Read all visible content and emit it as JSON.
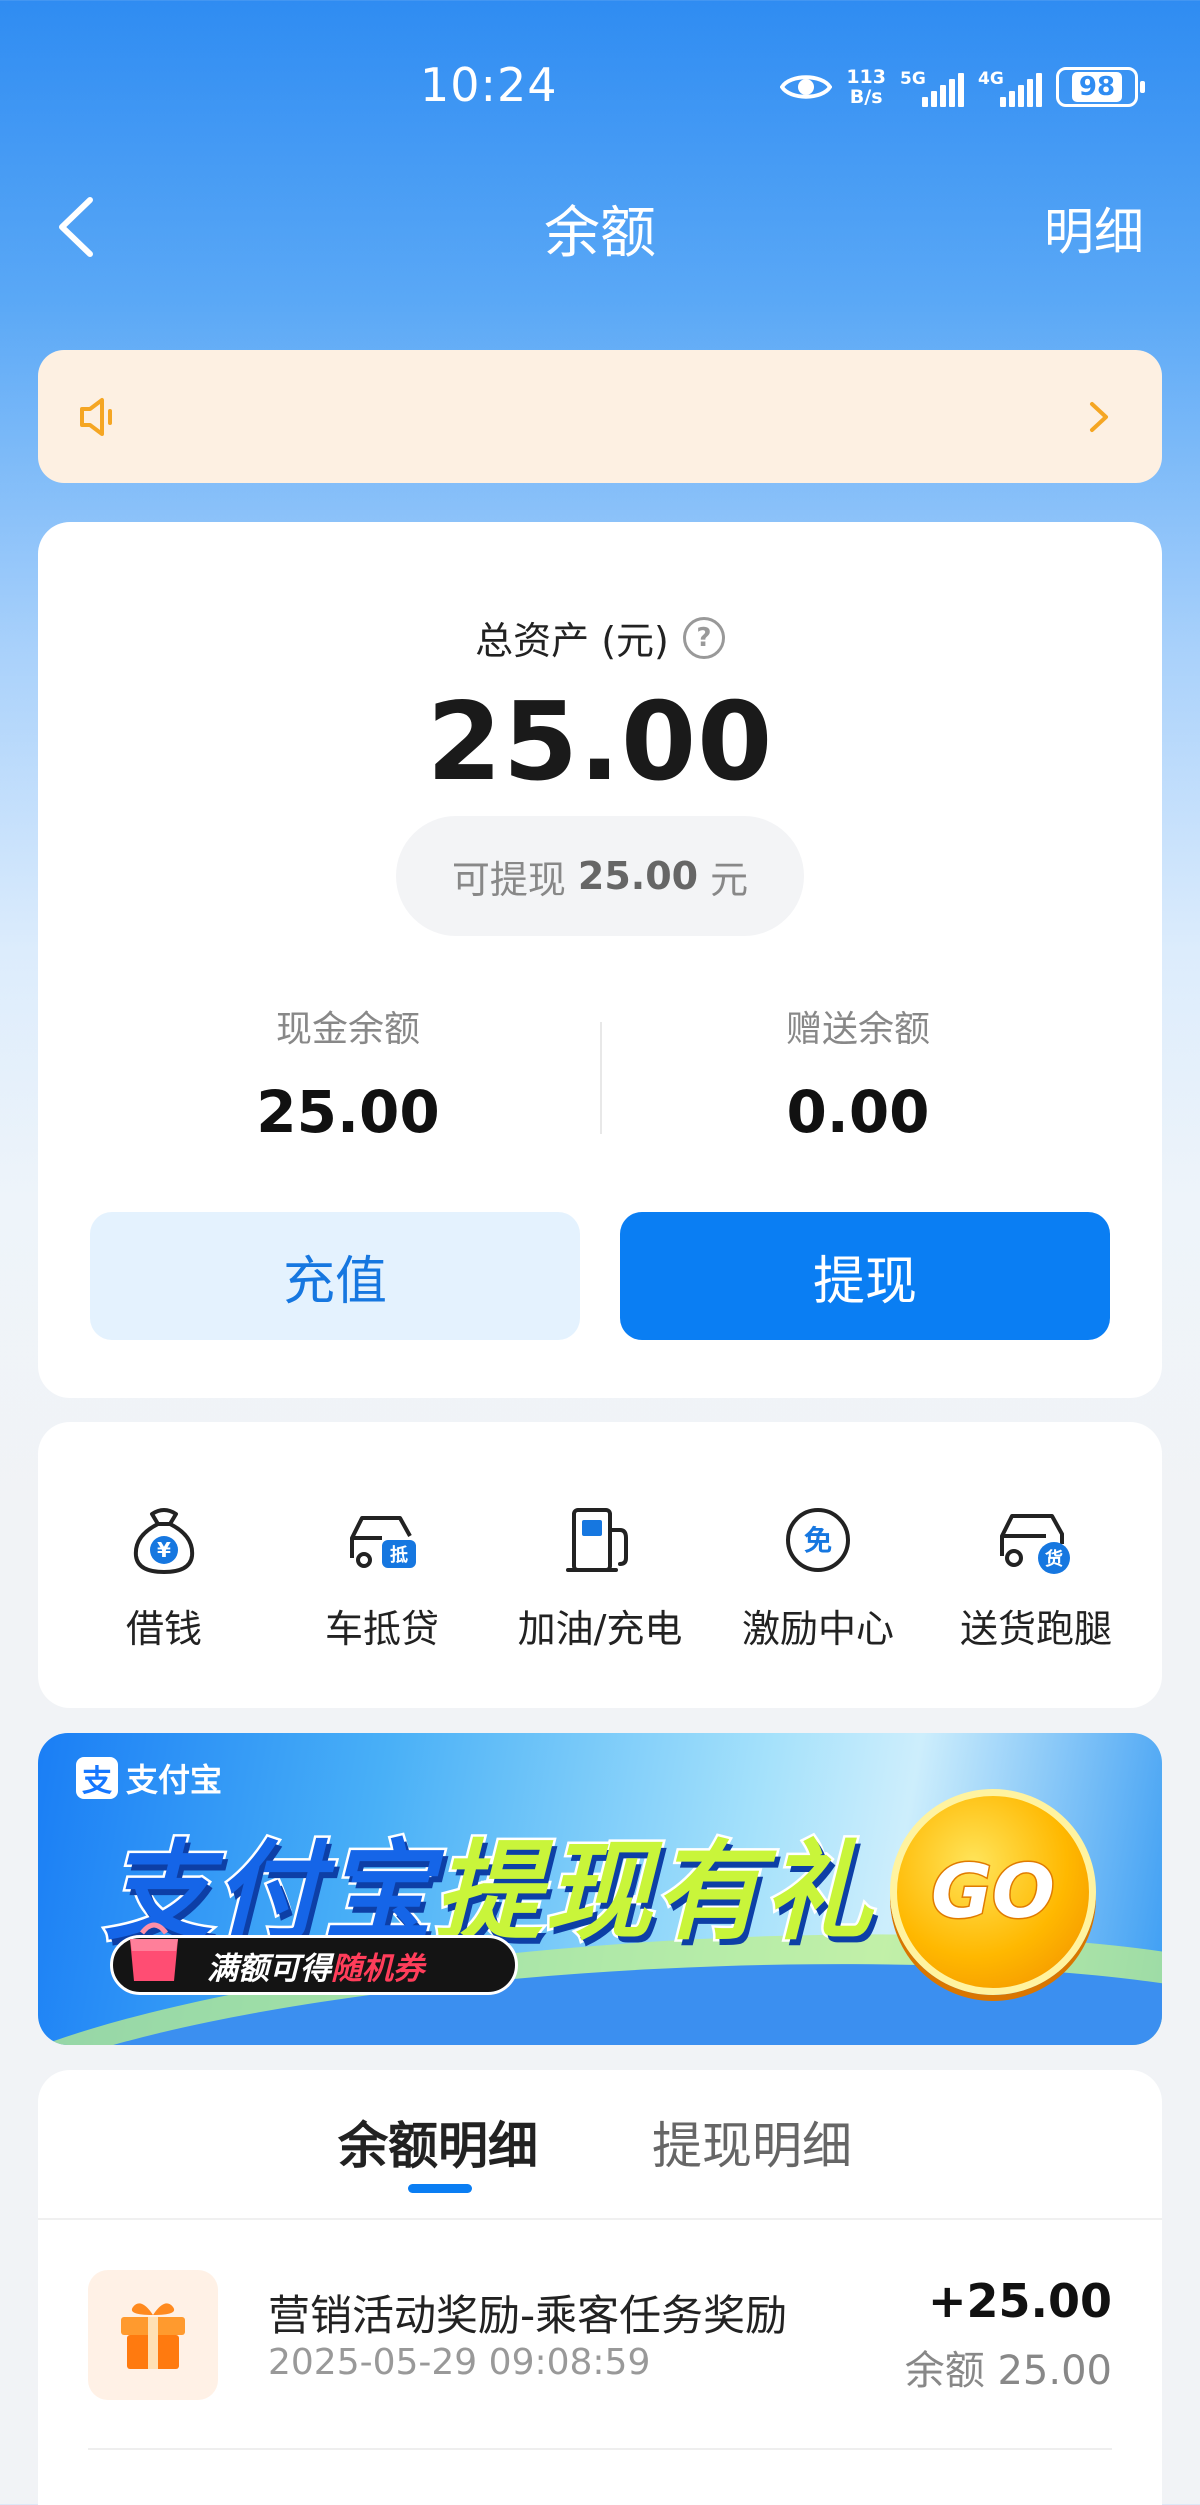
{
  "status_bar": {
    "time": "10:24",
    "net_speed_value": "113",
    "net_speed_unit": "B/s",
    "signal_1_label": "5G",
    "signal_2_label": "4G",
    "battery": "98"
  },
  "header": {
    "title": "余额",
    "detail_link": "明细"
  },
  "balance": {
    "total_label": "总资产 (元)",
    "total_value": "25.00",
    "withdrawable_prefix": "可提现",
    "withdrawable_amount": "25.00",
    "withdrawable_unit": "元",
    "cash_label": "现金余额",
    "cash_value": "25.00",
    "bonus_label": "赠送余额",
    "bonus_value": "0.00",
    "recharge_button": "充值",
    "withdraw_button": "提现"
  },
  "services": [
    {
      "label": "借钱",
      "icon": "money-bag-icon"
    },
    {
      "label": "车抵贷",
      "icon": "car-loan-icon"
    },
    {
      "label": "加油/充电",
      "icon": "fuel-pump-icon"
    },
    {
      "label": "激励中心",
      "icon": "free-badge-icon"
    },
    {
      "label": "送货跑腿",
      "icon": "delivery-truck-icon"
    }
  ],
  "banner": {
    "brand": "支付宝",
    "headline_part1": "支付宝",
    "headline_part2": "提现有礼",
    "tag_prefix": "满额可得",
    "tag_highlight": "随机券",
    "cta": "GO"
  },
  "details": {
    "tabs": [
      "余额明细",
      "提现明细"
    ],
    "active_tab": "余额明细",
    "records": [
      {
        "title": "营销活动奖励-乘客任务奖励",
        "time": "2025-05-29 09:08:59",
        "amount": "+25.00",
        "balance_text": "余额 25.00"
      }
    ]
  },
  "colors": {
    "primary": "#0a7ef3",
    "header_gradient_top": "#2f8cf2",
    "notice_bg": "#fdf0e2",
    "notice_icon": "#f5a623"
  }
}
